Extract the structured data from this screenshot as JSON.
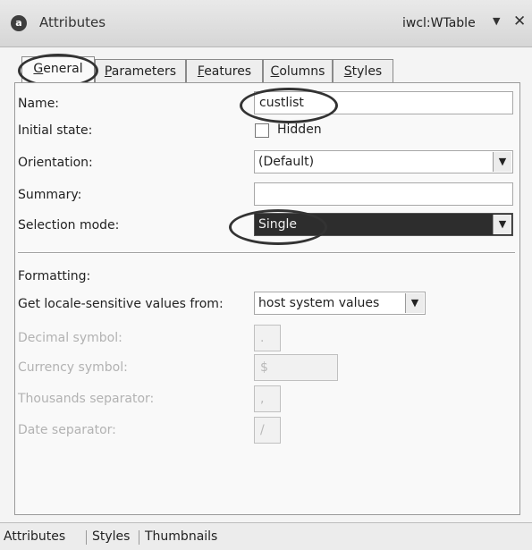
{
  "window": {
    "title": "Attributes",
    "component_type": "iwcl:WTable",
    "icon": "attributes-icon"
  },
  "tabs": [
    {
      "label": "General",
      "mnemonic": "G",
      "rest": "eneral",
      "active": true
    },
    {
      "label": "Parameters",
      "mnemonic": "P",
      "rest": "arameters",
      "active": false
    },
    {
      "label": "Features",
      "mnemonic": "F",
      "rest": "eatures",
      "active": false
    },
    {
      "label": "Columns",
      "mnemonic": "C",
      "rest": "olumns",
      "active": false
    },
    {
      "label": "Styles",
      "mnemonic": "S",
      "rest": "tyles",
      "active": false
    }
  ],
  "general": {
    "name_label": "Name:",
    "name_value": "custlist",
    "initial_state_label": "Initial state:",
    "hidden_label": "Hidden",
    "hidden_checked": false,
    "orientation_label": "Orientation:",
    "orientation_value": "(Default)",
    "summary_label": "Summary:",
    "summary_value": "",
    "selection_mode_label": "Selection mode:",
    "selection_mode_value": "Single"
  },
  "formatting": {
    "heading": "Formatting:",
    "locale_label": "Get locale-sensitive values from:",
    "locale_value": "host system values",
    "decimal_label": "Decimal symbol:",
    "decimal_value": ".",
    "currency_label": "Currency symbol:",
    "currency_value": "$",
    "thousands_label": "Thousands separator:",
    "thousands_value": ",",
    "date_label": "Date separator:",
    "date_value": "/"
  },
  "bottom_tabs": [
    "Attributes",
    "Styles",
    "Thumbnails"
  ]
}
